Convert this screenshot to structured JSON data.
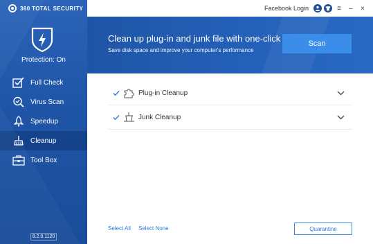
{
  "app": {
    "brand": "360 TOTAL SECURITY",
    "version": "8.2.0.1120",
    "colors": {
      "sidebar": "#1f55a6",
      "accent": "#3a8de8",
      "link": "#2f7ad9"
    }
  },
  "titlebar": {
    "facebook_login": "Facebook Login",
    "icons": [
      "user-icon",
      "shirt-icon",
      "menu-icon",
      "minimize-icon",
      "close-icon"
    ],
    "menu_glyph": "≡",
    "minimize_glyph": "–",
    "close_glyph": "×"
  },
  "sidebar": {
    "protection_status": "Protection: On",
    "items": [
      {
        "label": "Full Check",
        "icon": "checkbox-icon",
        "active": false
      },
      {
        "label": "Virus Scan",
        "icon": "virus-scan-icon",
        "active": false
      },
      {
        "label": "Speedup",
        "icon": "rocket-icon",
        "active": false
      },
      {
        "label": "Cleanup",
        "icon": "broom-icon",
        "active": true
      },
      {
        "label": "Tool Box",
        "icon": "toolbox-icon",
        "active": false
      }
    ]
  },
  "banner": {
    "title": "Clean up plug-in and junk file with one-click",
    "subtitle": "Save disk space and improve your computer's performance",
    "scan_label": "Scan"
  },
  "cleanup_items": [
    {
      "label": "Plug-in Cleanup",
      "checked": true,
      "icon": "puzzle-icon"
    },
    {
      "label": "Junk Cleanup",
      "checked": true,
      "icon": "trash-icon"
    }
  ],
  "footer": {
    "select_all": "Select All",
    "select_none": "Select None",
    "quarantine": "Quarantine"
  }
}
